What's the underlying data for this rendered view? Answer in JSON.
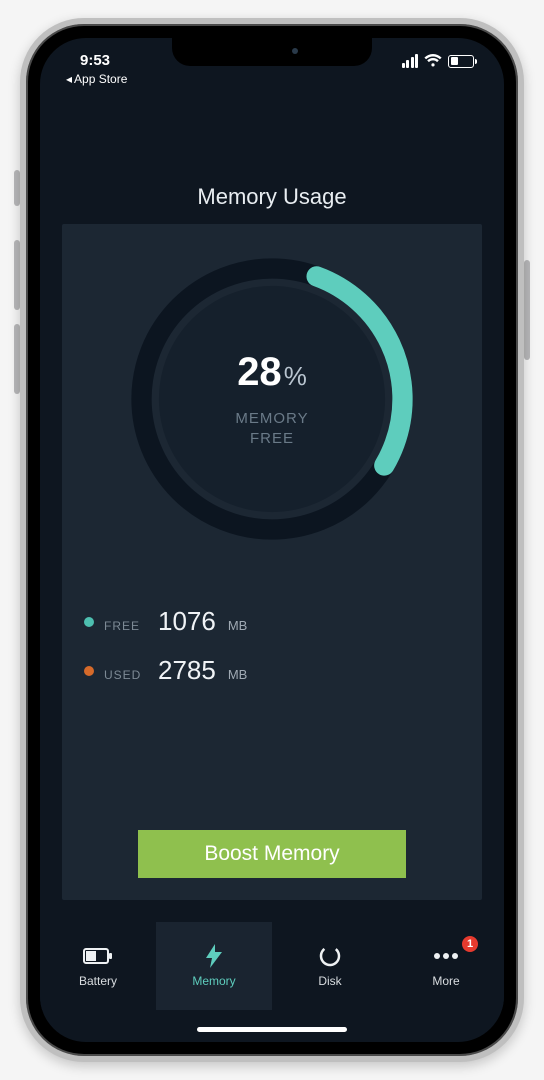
{
  "status": {
    "time": "9:53",
    "back_label": "App Store"
  },
  "page": {
    "title": "Memory Usage"
  },
  "ring": {
    "percent_value": "28",
    "percent_sign": "%",
    "label_line1": "MEMORY",
    "label_line2": "FREE",
    "fraction_free": 0.28
  },
  "stats": {
    "free_label": "FREE",
    "free_value": "1076",
    "free_unit": "MB",
    "used_label": "USED",
    "used_value": "2785",
    "used_unit": "MB"
  },
  "actions": {
    "boost_label": "Boost Memory"
  },
  "tabs": {
    "battery": "Battery",
    "memory": "Memory",
    "disk": "Disk",
    "more": "More",
    "more_badge": "1"
  },
  "colors": {
    "accent": "#5ecdbd",
    "free": "#4dbfb0",
    "used": "#d66a2a",
    "boost": "#8fc04e"
  }
}
